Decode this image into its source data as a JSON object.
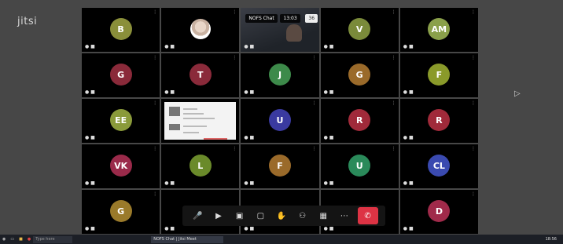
{
  "app": {
    "logo": "jitsi"
  },
  "active_tile_badges": {
    "title": "NOFS Chat",
    "timer": "13:03",
    "count": "36"
  },
  "tiles": [
    {
      "initials": "B",
      "color": "#8a8f3a"
    },
    {
      "initials": "",
      "color": ""
    },
    {
      "initials": "",
      "color": ""
    },
    {
      "initials": "V",
      "color": "#7a8a3a"
    },
    {
      "initials": "AM",
      "color": "#8aa04a"
    },
    {
      "initials": "G",
      "color": "#8a2a3a"
    },
    {
      "initials": "T",
      "color": "#8a2a3a"
    },
    {
      "initials": "J",
      "color": "#3d8a4a"
    },
    {
      "initials": "G",
      "color": "#9a6a2a"
    },
    {
      "initials": "F",
      "color": "#8a9a2a"
    },
    {
      "initials": "EE",
      "color": "#8a9a3a"
    },
    {
      "initials": "",
      "color": ""
    },
    {
      "initials": "U",
      "color": "#3a3aa0"
    },
    {
      "initials": "R",
      "color": "#a02a3a"
    },
    {
      "initials": "R",
      "color": "#a02a3a"
    },
    {
      "initials": "VK",
      "color": "#9a2a4a"
    },
    {
      "initials": "L",
      "color": "#6a8a2a"
    },
    {
      "initials": "F",
      "color": "#9a6a2a"
    },
    {
      "initials": "U",
      "color": "#2a8a5a"
    },
    {
      "initials": "CL",
      "color": "#3a4ab0"
    },
    {
      "initials": "G",
      "color": "#9a7a2a"
    },
    {
      "initials": "",
      "color": ""
    },
    {
      "initials": "",
      "color": ""
    },
    {
      "initials": "",
      "color": ""
    },
    {
      "initials": "D",
      "color": "#a02a4a"
    }
  ],
  "toolbar": {
    "icons": [
      "microphone-icon",
      "camera-icon",
      "screen-share-icon",
      "chat-icon",
      "raise-hand-icon",
      "participants-icon",
      "tile-view-icon",
      "more-icon",
      "hangup-icon"
    ]
  },
  "taskbar": {
    "search_placeholder": "Type here",
    "active_task": "NOFS Chat | Jitsi Meet",
    "clock": "18:56"
  }
}
